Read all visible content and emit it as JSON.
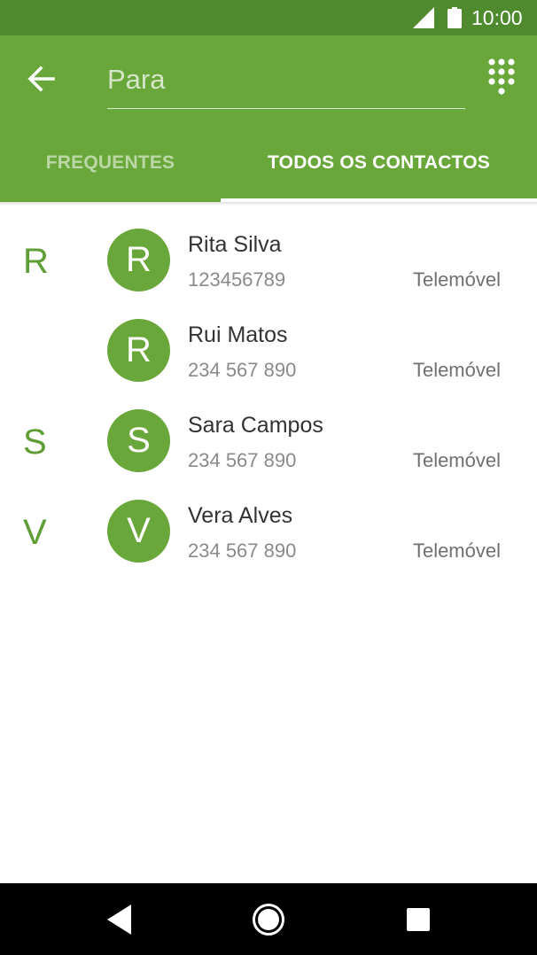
{
  "status_bar": {
    "time": "10:00",
    "icons": [
      "signal-icon",
      "battery-icon"
    ]
  },
  "header": {
    "back_icon": "arrow-left-icon",
    "search": {
      "placeholder": "Para",
      "value": ""
    },
    "dialpad_icon": "dialpad-icon"
  },
  "tabs": [
    {
      "label": "FREQUENTES",
      "selected": false
    },
    {
      "label": "TODOS OS CONTACTOS",
      "selected": true
    }
  ],
  "contacts": [
    {
      "section": "R",
      "initial": "R",
      "name": "Rita Silva",
      "number": "123456789",
      "type": "Telemóvel"
    },
    {
      "section": "",
      "initial": "R",
      "name": "Rui Matos",
      "number": "234 567 890",
      "type": "Telemóvel"
    },
    {
      "section": "S",
      "initial": "S",
      "name": "Sara Campos",
      "number": "234 567 890",
      "type": "Telemóvel"
    },
    {
      "section": "V",
      "initial": "V",
      "name": "Vera Alves",
      "number": "234 567 890",
      "type": "Telemóvel"
    }
  ],
  "nav_bar": {
    "icons": [
      "back-triangle-icon",
      "home-circle-icon",
      "recents-square-icon"
    ]
  },
  "colors": {
    "status_bar": "#4f8a2e",
    "app_bar": "#6aa73b",
    "accent": "#5e9e34",
    "avatar": "#6aa73b"
  }
}
